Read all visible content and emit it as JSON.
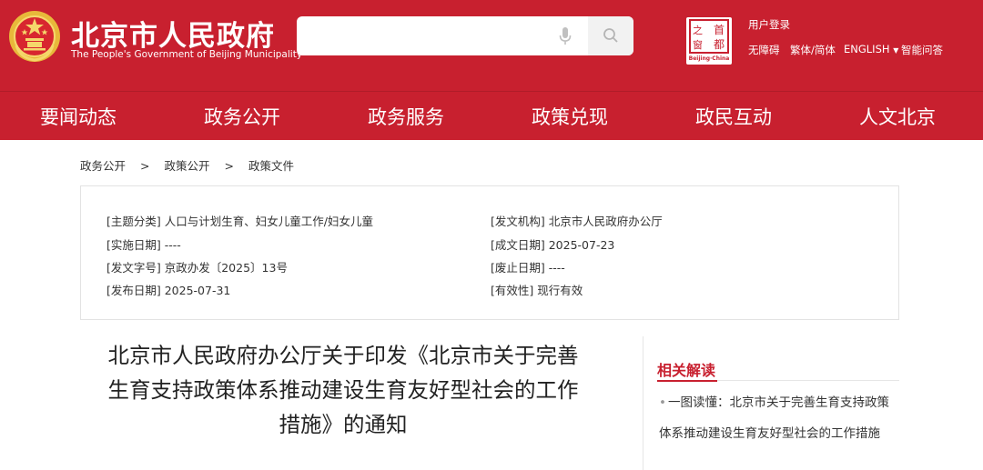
{
  "header": {
    "site_title": "北京市人民政府",
    "site_subtitle": "The People's Government of Beijing Municipality",
    "search": {
      "value": "",
      "placeholder": ""
    },
    "logo2_caption": "Beijing·China",
    "user_login": "用户登录",
    "utilities": [
      "无障碍",
      "繁体/简体",
      "ENGLISH",
      "智能问答"
    ],
    "brand_color": "#c8202f"
  },
  "nav": {
    "items": [
      "要闻动态",
      "政务公开",
      "政务服务",
      "政策兑现",
      "政民互动",
      "人文北京"
    ]
  },
  "breadcrumb": [
    "政务公开",
    "政策公开",
    "政策文件"
  ],
  "breadcrumb_separator": ">",
  "info": {
    "left": [
      "[主题分类] 人口与计划生育、妇女儿童工作/妇女儿童",
      "[实施日期] ----",
      "[发文字号] 京政办发〔2025〕13号",
      "[发布日期] 2025-07-31"
    ],
    "right": [
      "[发文机构] 北京市人民政府办公厅",
      "[成文日期] 2025-07-23",
      "[废止日期] ----",
      "[有效性] 现行有效"
    ]
  },
  "article": {
    "title_lines": [
      "北京市人民政府办公厅关于印发《北京市关于完善",
      "生育支持政策体系推动建设生育友好型社会的工作",
      "措施》的通知"
    ]
  },
  "related": {
    "heading": "相关解读",
    "bullet": "•",
    "items": [
      "一图读懂：北京市关于完善生育支持政策体系推动建设生育友好型社会的工作措施"
    ]
  },
  "icons": [
    "national-emblem-icon",
    "microphone-icon",
    "search-icon",
    "beijing-seal-logo-icon",
    "dropdown-caret-icon"
  ]
}
